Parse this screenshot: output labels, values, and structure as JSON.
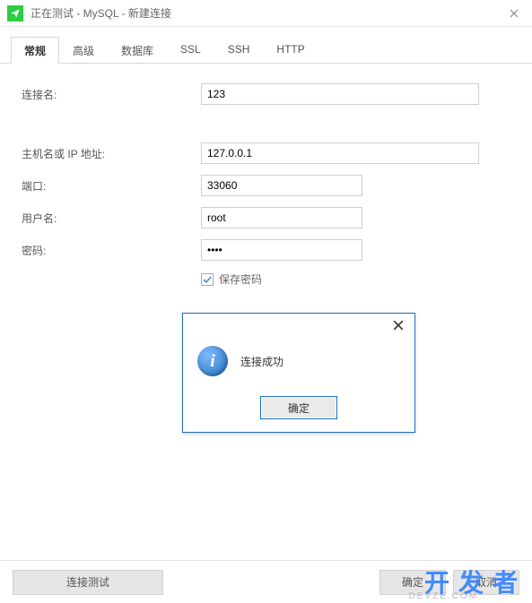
{
  "window": {
    "title": "正在测试 - MySQL - 新建连接"
  },
  "tabs": [
    {
      "label": "常规",
      "active": true
    },
    {
      "label": "高级",
      "active": false
    },
    {
      "label": "数据库",
      "active": false
    },
    {
      "label": "SSL",
      "active": false
    },
    {
      "label": "SSH",
      "active": false
    },
    {
      "label": "HTTP",
      "active": false
    }
  ],
  "form": {
    "connection_name": {
      "label": "连接名:",
      "value": "123"
    },
    "host": {
      "label": "主机名或 IP 地址:",
      "value": "127.0.0.1"
    },
    "port": {
      "label": "端口:",
      "value": "33060"
    },
    "username": {
      "label": "用户名:",
      "value": "root"
    },
    "password": {
      "label": "密码:",
      "value": "••••"
    },
    "save_password": {
      "label": "保存密码",
      "checked": true
    }
  },
  "footer": {
    "test_connection": "连接测试",
    "ok": "确定",
    "cancel": "取消"
  },
  "dialog": {
    "message": "连接成功",
    "ok": "确定",
    "icon_glyph": "i"
  },
  "watermark": {
    "main": "开发者",
    "sub": "DEVZE.COM"
  }
}
